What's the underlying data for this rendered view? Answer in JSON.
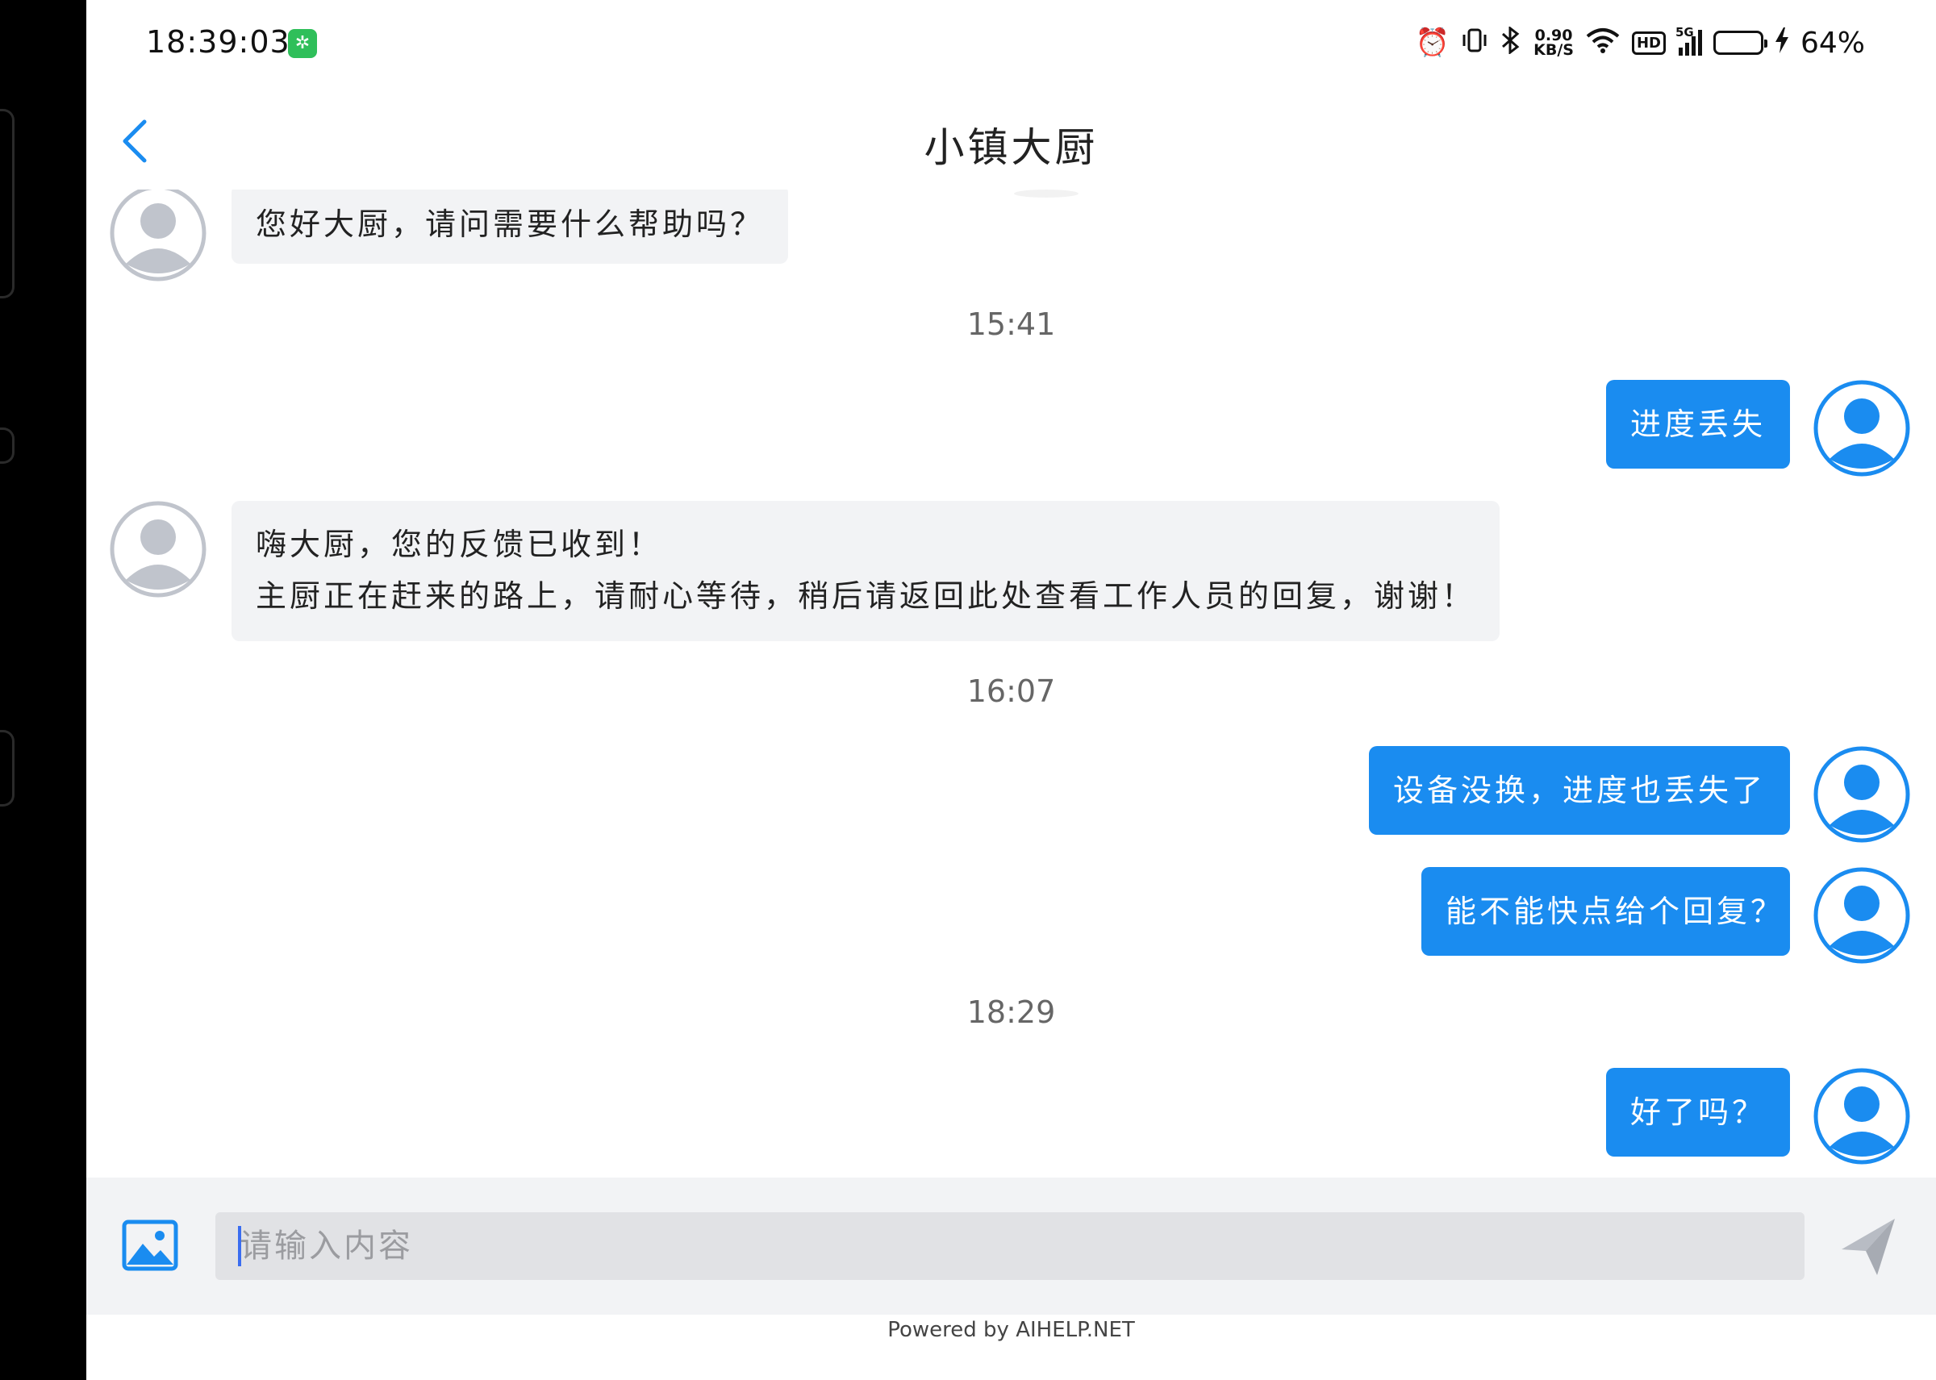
{
  "status_bar": {
    "time": "18:39:03",
    "net_speed_value": "0.90",
    "net_speed_unit": "KB/S",
    "hd_label": "HD",
    "network_type": "5G",
    "battery_percent": "64%",
    "battery_level": 0.64
  },
  "header": {
    "title": "小镇大厨"
  },
  "messages": [
    {
      "sender": "agent",
      "text": "您好大厨，请问需要什么帮助吗？"
    },
    {
      "type": "timestamp",
      "text": "15:41"
    },
    {
      "sender": "user",
      "text": "进度丢失"
    },
    {
      "sender": "agent",
      "line1": "嗨大厨，您的反馈已收到！",
      "line2": "主厨正在赶来的路上，请耐心等待，稍后请返回此处查看工作人员的回复，谢谢！"
    },
    {
      "type": "timestamp",
      "text": "16:07"
    },
    {
      "sender": "user",
      "text": "设备没换，进度也丢失了"
    },
    {
      "sender": "user",
      "text": "能不能快点给个回复？"
    },
    {
      "type": "timestamp",
      "text": "18:29"
    },
    {
      "sender": "user",
      "text": "好了吗？"
    }
  ],
  "input": {
    "placeholder": "请输入内容",
    "value": ""
  },
  "footer": {
    "powered_by": "Powered by AIHELP.NET"
  },
  "colors": {
    "accent": "#1a8cf0",
    "agent_bubble": "#f2f3f5",
    "agent_avatar": "#c0c4cc"
  }
}
